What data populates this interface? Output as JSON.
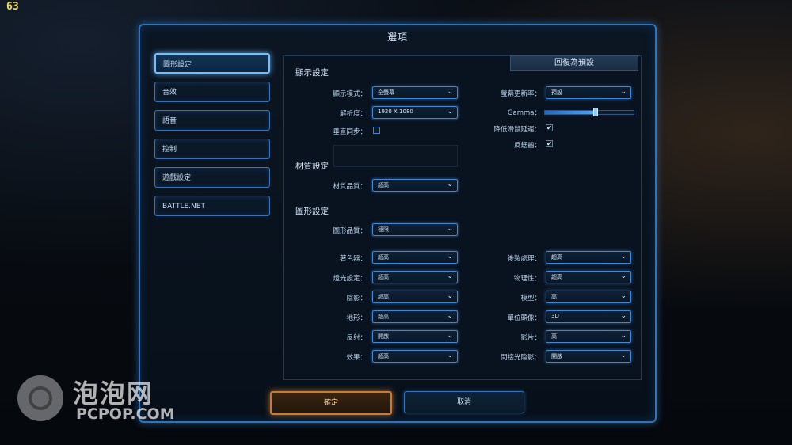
{
  "fps": "63",
  "dialog": {
    "title": "選項"
  },
  "nav": [
    {
      "label": "圖形設定",
      "active": true
    },
    {
      "label": "音效",
      "active": false
    },
    {
      "label": "語音",
      "active": false
    },
    {
      "label": "控制",
      "active": false
    },
    {
      "label": "遊戲設定",
      "active": false
    },
    {
      "label": "BATTLE.NET",
      "active": false
    }
  ],
  "reset_label": "回復為預設",
  "display": {
    "heading": "顯示設定",
    "mode_label": "顯示模式：",
    "mode_value": "全螢幕",
    "resolution_label": "解析度：",
    "resolution_value": "1920 X 1080",
    "vsync_label": "垂直同步：",
    "vsync_checked": false,
    "refresh_label": "螢幕更新率：",
    "refresh_value": "預設",
    "gamma_label": "Gamma：",
    "gamma_level": 0.57,
    "mouse_lag_label": "降低滑鼠延遲：",
    "mouse_lag_checked": true,
    "aa_label": "反鋸齒：",
    "aa_checked": true
  },
  "texture": {
    "heading": "材質設定",
    "quality_label": "材質品質：",
    "quality_value": "超高"
  },
  "graphics": {
    "heading": "圖形設定",
    "quality_label": "圖形品質：",
    "quality_value": "極限",
    "left": [
      {
        "label": "著色器：",
        "value": "超高"
      },
      {
        "label": "燈光設定：",
        "value": "超高"
      },
      {
        "label": "陰影：",
        "value": "超高"
      },
      {
        "label": "地形：",
        "value": "超高"
      },
      {
        "label": "反射：",
        "value": "開啟"
      },
      {
        "label": "效果：",
        "value": "超高"
      }
    ],
    "right": [
      {
        "label": "後製處理：",
        "value": "超高"
      },
      {
        "label": "物理性：",
        "value": "超高"
      },
      {
        "label": "模型：",
        "value": "高"
      },
      {
        "label": "單位頭像：",
        "value": "3D"
      },
      {
        "label": "影片：",
        "value": "高"
      },
      {
        "label": "間接光陰影：",
        "value": "開啟"
      }
    ]
  },
  "buttons": {
    "ok": "確定",
    "cancel": "取消"
  },
  "watermark": {
    "cn": "泡泡网",
    "en": "PCPOP.COM"
  },
  "icons": {
    "dropdown": "chevron-down-icon",
    "checkbox": "check-icon"
  }
}
